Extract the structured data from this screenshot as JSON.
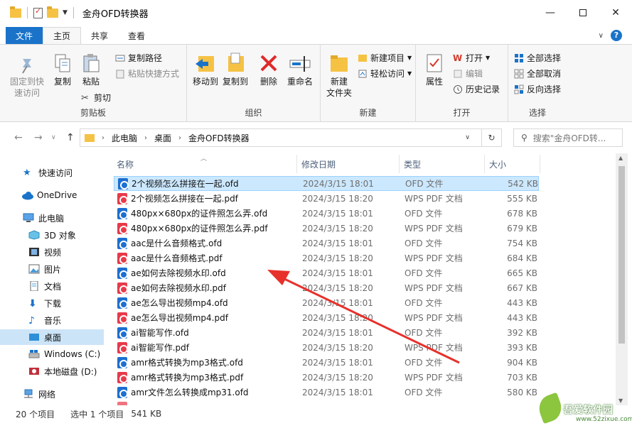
{
  "window": {
    "title": "金舟OFD转换器"
  },
  "ribbon_tabs": [
    "文件",
    "主页",
    "共享",
    "查看"
  ],
  "ribbon": {
    "clipboard": {
      "pin_label_1": "固定到快",
      "pin_label_2": "速访问",
      "copy": "复制",
      "paste": "粘贴",
      "copy_path": "复制路径",
      "paste_shortcut": "粘贴快捷方式",
      "cut": "剪切",
      "group": "剪贴板"
    },
    "organize": {
      "move_to": "移动到",
      "copy_to": "复制到",
      "delete": "删除",
      "rename": "重命名",
      "group": "组织"
    },
    "new": {
      "new_folder_1": "新建",
      "new_folder_2": "文件夹",
      "new_item": "新建项目",
      "easy_access": "轻松访问",
      "group": "新建"
    },
    "open": {
      "properties": "属性",
      "open": "打开",
      "edit": "编辑",
      "history": "历史记录",
      "group": "打开"
    },
    "select": {
      "select_all": "全部选择",
      "select_none": "全部取消",
      "invert": "反向选择",
      "group": "选择"
    }
  },
  "address": {
    "crumbs": [
      "此电脑",
      "桌面",
      "金舟OFD转换器"
    ],
    "search_placeholder": "搜索\"金舟OFD转..."
  },
  "nav": {
    "items": [
      {
        "label": "快速访问",
        "icon": "star-icon"
      },
      {
        "label": "OneDrive",
        "icon": "cloud-icon"
      },
      {
        "label": "此电脑",
        "icon": "pc-icon"
      },
      {
        "label": "3D 对象",
        "icon": "cube-icon"
      },
      {
        "label": "视频",
        "icon": "video-icon"
      },
      {
        "label": "图片",
        "icon": "picture-icon"
      },
      {
        "label": "文档",
        "icon": "document-icon"
      },
      {
        "label": "下载",
        "icon": "download-icon"
      },
      {
        "label": "音乐",
        "icon": "music-icon"
      },
      {
        "label": "桌面",
        "icon": "desktop-icon"
      },
      {
        "label": "Windows (C:)",
        "icon": "drive-icon"
      },
      {
        "label": "本地磁盘 (D:)",
        "icon": "drive-icon"
      },
      {
        "label": "网络",
        "icon": "network-icon"
      }
    ]
  },
  "columns": {
    "name": "名称",
    "date": "修改日期",
    "type": "类型",
    "size": "大小"
  },
  "files": [
    {
      "name": "2个视频怎么拼接在一起.ofd",
      "date": "2024/3/15 18:01",
      "type": "OFD 文件",
      "size": "542 KB",
      "kind": "ofd"
    },
    {
      "name": "2个视频怎么拼接在一起.pdf",
      "date": "2024/3/15 18:20",
      "type": "WPS PDF 文档",
      "size": "555 KB",
      "kind": "pdf"
    },
    {
      "name": "480px×680px的证件照怎么弄.ofd",
      "date": "2024/3/15 18:01",
      "type": "OFD 文件",
      "size": "678 KB",
      "kind": "ofd"
    },
    {
      "name": "480px×680px的证件照怎么弄.pdf",
      "date": "2024/3/15 18:20",
      "type": "WPS PDF 文档",
      "size": "679 KB",
      "kind": "pdf"
    },
    {
      "name": "aac是什么音频格式.ofd",
      "date": "2024/3/15 18:01",
      "type": "OFD 文件",
      "size": "754 KB",
      "kind": "ofd"
    },
    {
      "name": "aac是什么音频格式.pdf",
      "date": "2024/3/15 18:20",
      "type": "WPS PDF 文档",
      "size": "684 KB",
      "kind": "pdf"
    },
    {
      "name": "ae如何去除视频水印.ofd",
      "date": "2024/3/15 18:01",
      "type": "OFD 文件",
      "size": "665 KB",
      "kind": "ofd"
    },
    {
      "name": "ae如何去除视频水印.pdf",
      "date": "2024/3/15 18:20",
      "type": "WPS PDF 文档",
      "size": "667 KB",
      "kind": "pdf"
    },
    {
      "name": "ae怎么导出视频mp4.ofd",
      "date": "2024/3/15 18:01",
      "type": "OFD 文件",
      "size": "443 KB",
      "kind": "ofd"
    },
    {
      "name": "ae怎么导出视频mp4.pdf",
      "date": "2024/3/15 18:20",
      "type": "WPS PDF 文档",
      "size": "443 KB",
      "kind": "pdf"
    },
    {
      "name": "ai智能写作.ofd",
      "date": "2024/3/15 18:01",
      "type": "OFD 文件",
      "size": "392 KB",
      "kind": "ofd"
    },
    {
      "name": "ai智能写作.pdf",
      "date": "2024/3/15 18:20",
      "type": "WPS PDF 文档",
      "size": "393 KB",
      "kind": "pdf"
    },
    {
      "name": "amr格式转换为mp3格式.ofd",
      "date": "2024/3/15 18:01",
      "type": "OFD 文件",
      "size": "904 KB",
      "kind": "ofd"
    },
    {
      "name": "amr格式转换为mp3格式.pdf",
      "date": "2024/3/15 18:20",
      "type": "WPS PDF 文档",
      "size": "703 KB",
      "kind": "pdf"
    },
    {
      "name": "amr文件怎么转换成mp31.ofd",
      "date": "2024/3/15 18:01",
      "type": "OFD 文件",
      "size": "580 KB",
      "kind": "ofd"
    }
  ],
  "status": {
    "count": "20 个项目",
    "selected": "选中 1 个项目",
    "size": "541 KB"
  },
  "watermark": {
    "text": "吾爱软件园",
    "url": "www.52zixue.com"
  },
  "colors": {
    "accent": "#1a73c9",
    "selection": "#cce8ff",
    "ofd_icon": "#1d6fd1",
    "pdf_icon": "#e83a4a",
    "annotation_arrow": "#e8302a"
  }
}
